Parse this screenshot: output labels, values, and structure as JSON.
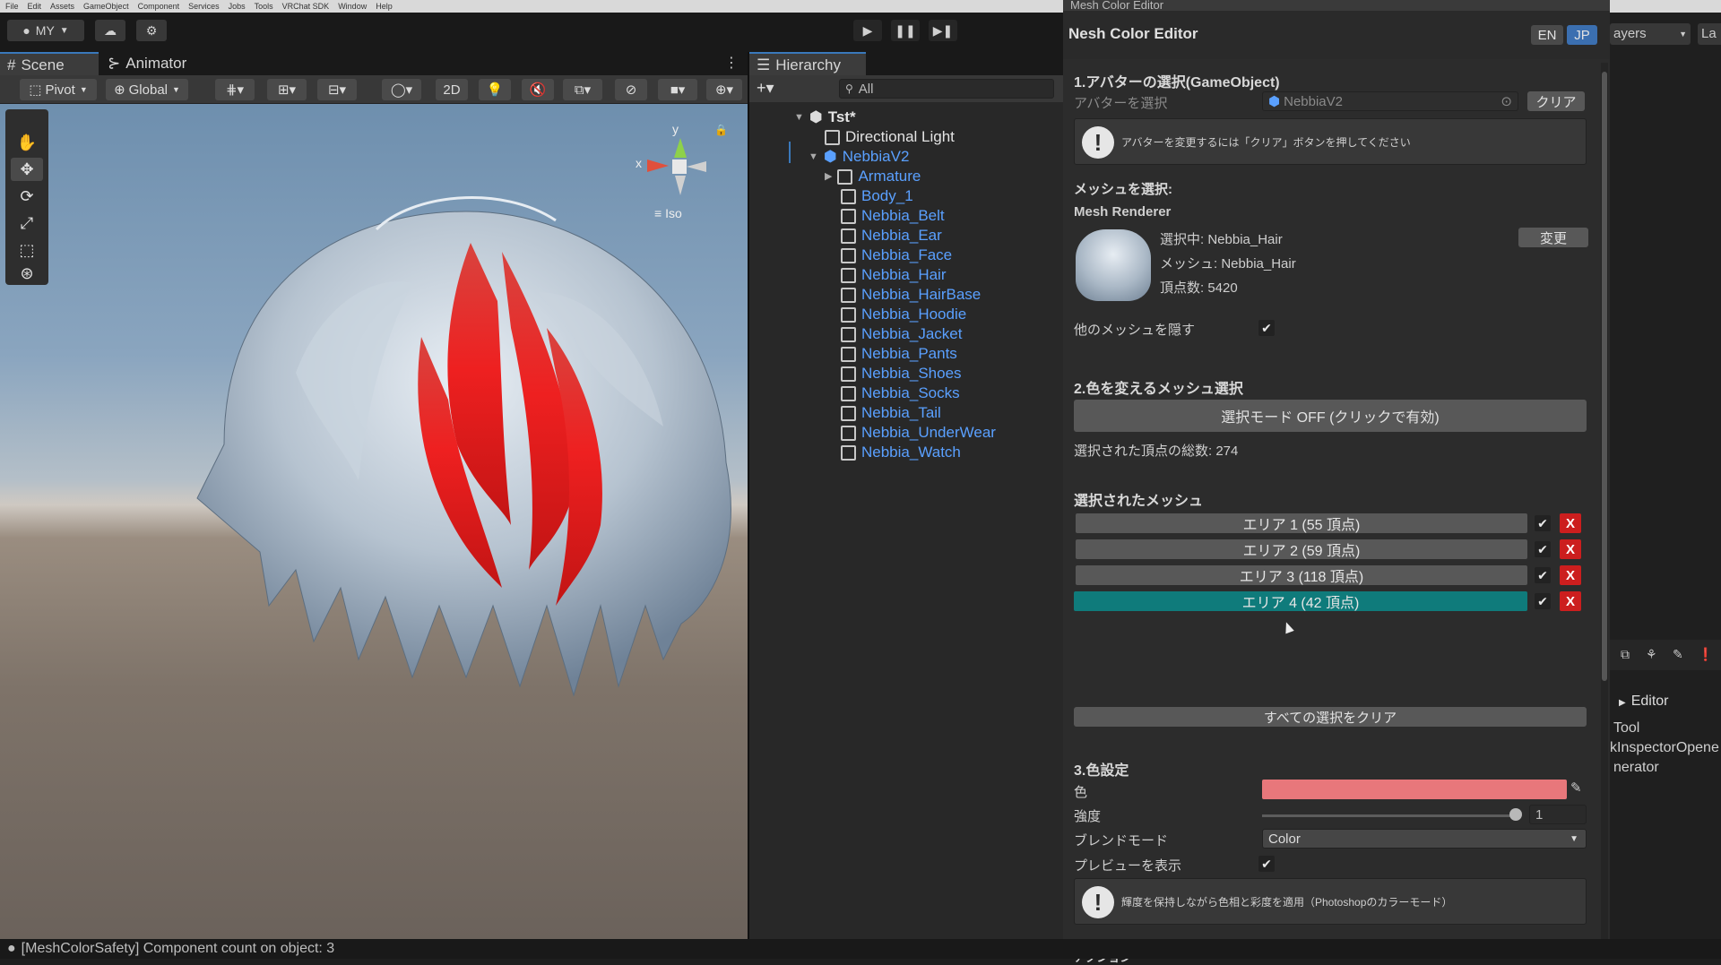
{
  "menu": [
    "File",
    "Edit",
    "Assets",
    "GameObject",
    "Component",
    "Services",
    "Jobs",
    "Tools",
    "VRChat SDK",
    "Window",
    "Help"
  ],
  "toolbar": {
    "account_label": "MY"
  },
  "scene": {
    "tabs": [
      {
        "label": "Scene"
      },
      {
        "label": "Animator"
      }
    ],
    "pivot_label": "Pivot",
    "global_label": "Global",
    "mode_2d_label": "2D",
    "gizmo_y": "y",
    "gizmo_x": "x",
    "iso_label": "Iso"
  },
  "hierarchy": {
    "tab_label": "Hierarchy",
    "search_placeholder": "All",
    "root": "Tst*",
    "items": [
      {
        "label": "Directional Light"
      },
      {
        "label": "NebbiaV2"
      },
      {
        "label": "Armature"
      },
      {
        "label": "Body_1"
      },
      {
        "label": "Nebbia_Belt"
      },
      {
        "label": "Nebbia_Ear"
      },
      {
        "label": "Nebbia_Face"
      },
      {
        "label": "Nebbia_Hair"
      },
      {
        "label": "Nebbia_HairBase"
      },
      {
        "label": "Nebbia_Hoodie"
      },
      {
        "label": "Nebbia_Jacket"
      },
      {
        "label": "Nebbia_Pants"
      },
      {
        "label": "Nebbia_Shoes"
      },
      {
        "label": "Nebbia_Socks"
      },
      {
        "label": "Nebbia_Tail"
      },
      {
        "label": "Nebbia_UnderWear"
      },
      {
        "label": "Nebbia_Watch"
      }
    ]
  },
  "editor": {
    "window_title": "Mesh Color Editor",
    "header_title": "Nesh Color Editor",
    "lang_en": "EN",
    "lang_jp": "JP",
    "sec1_title": "1.アバターの選択(GameObject)",
    "avatar_label": "アバターを選択",
    "avatar_value": "NebbiaV2",
    "clear_button": "クリア",
    "avatar_help": "アバターを変更するには「クリア」ボタンを押してください",
    "mesh_select_title": "メッシュを選択:",
    "mesh_renderer_label": "Mesh Renderer",
    "selected_label": "選択中: Nebbia_Hair",
    "mesh_label": "メッシュ: Nebbia_Hair",
    "vertex_count": "頂点数: 5420",
    "change_button": "変更",
    "hide_other_label": "他のメッシュを隠す",
    "sec2_title": "2.色を変えるメッシュ選択",
    "select_mode_button": "選択モード OFF (クリックで有効)",
    "total_vertices": "選択された頂点の総数: 274",
    "selected_mesh_title": "選択されたメッシュ",
    "areas": [
      {
        "label": "エリア 1 (55 頂点)"
      },
      {
        "label": "エリア 2 (59 頂点)"
      },
      {
        "label": "エリア 3 (118 頂点)"
      },
      {
        "label": "エリア 4 (42 頂点)"
      }
    ],
    "clear_all_button": "すべての選択をクリア",
    "sec3_title": "3.色設定",
    "color_label": "色",
    "color_value": "#e8777b",
    "intensity_label": "強度",
    "intensity_value": "1",
    "blend_label": "ブレンドモード",
    "blend_value": "Color",
    "preview_label": "プレビューを表示",
    "color_help": "輝度を保持しながら色相と彩度を適用（Photoshopのカラーモード）",
    "actions_title": "アクション"
  },
  "right_panel": {
    "layers_label": "ayers",
    "layout_label": "La",
    "folder": "Editor",
    "items": [
      "Tool",
      "kInspectorOpene",
      "nerator"
    ]
  },
  "status": {
    "message": "[MeshColorSafety] Component count on object: 3"
  }
}
